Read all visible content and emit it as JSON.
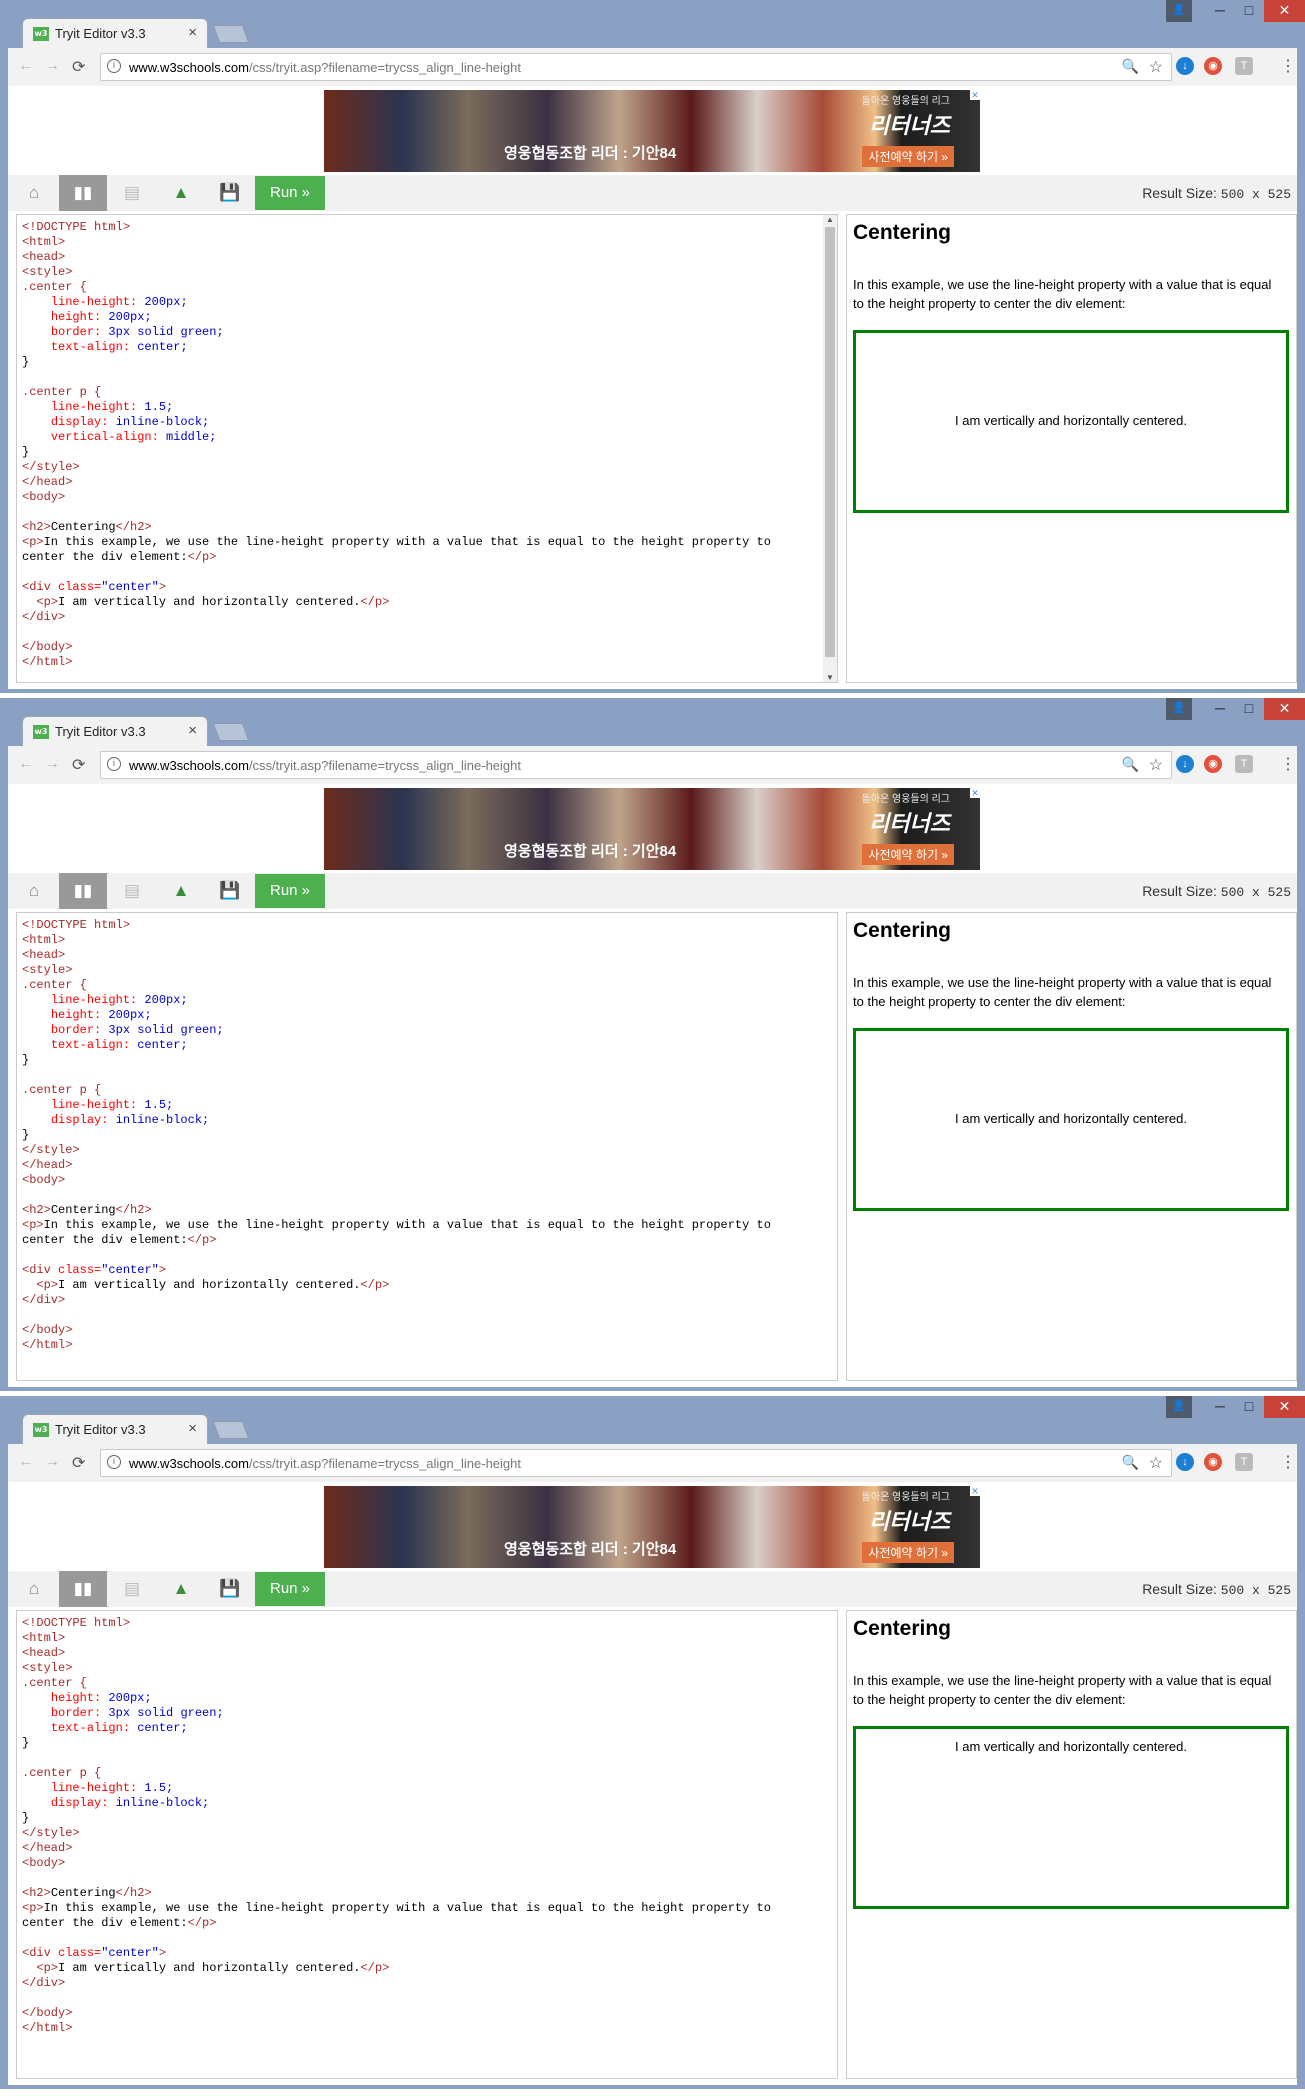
{
  "browser": {
    "tab_title": "Tryit Editor v3.3",
    "favicon_text": "w3",
    "tab_close": "×",
    "url_host": "www.w3schools.com",
    "url_path": "/css/tryit.asp?filename=trycss_align_line-height",
    "window_controls": {
      "user": "👤",
      "minimize": "─",
      "maximize": "□",
      "close": "✕"
    },
    "nav": {
      "back": "←",
      "forward": "→",
      "reload": "⟳",
      "zoom": "🔍",
      "bookmark": "☆",
      "menu": "⋮"
    },
    "extensions": [
      {
        "name": "download-icon",
        "glyph": "↓",
        "color": "#1d7fd4"
      },
      {
        "name": "extension-icon",
        "glyph": "◉",
        "color": "#e0523c"
      },
      {
        "name": "translate-icon",
        "glyph": "T",
        "color": "#bbbbbb"
      }
    ]
  },
  "ad": {
    "caption": "영웅협동조합 리더 : 기안84",
    "top_text": "돌아온 영웅들의 리그",
    "brand": "리터너즈",
    "cta": "사전예약 하기 »",
    "close_glyph": "✕"
  },
  "toolbar": {
    "home_icon": "⌂",
    "split_icon": "▮▮",
    "rows_icon": "▤",
    "drive_icon": "▲",
    "save_icon": "💾",
    "run_label": "Run »",
    "result_size_label": "Result Size:",
    "result_size_value": "500 x 525"
  },
  "result": {
    "heading": "Centering",
    "paragraph": "In this example, we use the line-height property with a value that is equal to the height property to center the div element:",
    "centered_text": "I am vertically and horizontally centered."
  },
  "scrollbar": {
    "up": "▲",
    "down": "▼"
  },
  "code_lines": {
    "doctype": "<!DOCTYPE html>",
    "html_open": "<html>",
    "head_open": "<head>",
    "style_open": "<style>",
    "center_sel": ".center {",
    "lh_prop": "line-height:",
    "lh_200": " 200px;",
    "height_prop": "height:",
    "height_val": " 200px;",
    "border_prop": "border:",
    "border_val": " 3px solid green;",
    "ta_prop": "text-align:",
    "ta_val": " center;",
    "close_brace": "}",
    "center_p_sel": ".center p {",
    "lh_15": " 1.5;",
    "display_prop": "display:",
    "display_val": " inline-block;",
    "va_prop": "vertical-align:",
    "va_val": " middle;",
    "style_close": "</style>",
    "head_close": "</head>",
    "body_open": "<body>",
    "h2_open": "<h2>",
    "h2_text": "Centering",
    "h2_close": "</h2>",
    "p_open": "<p>",
    "p_text1": "In this example, we use the line-height property with a value that is equal to the height property to",
    "p_text2": "center the div element:",
    "p_close": "</p>",
    "div_open_a": "<div ",
    "div_class_attr": "class=",
    "div_class_val": "\"center\"",
    "div_open_b": ">",
    "inner_p_indent": "  ",
    "inner_p_text": "I am vertically and horizontally centered.",
    "div_close": "</div>",
    "body_close": "</body>",
    "html_close": "</html>"
  }
}
